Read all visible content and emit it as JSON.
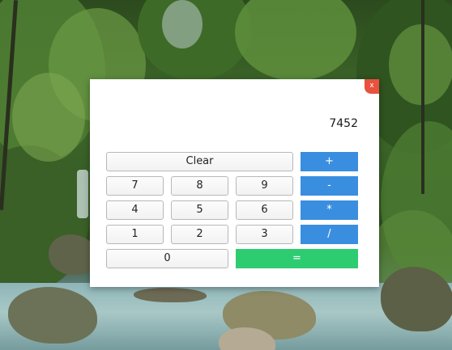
{
  "window": {
    "close_label": "x"
  },
  "calculator": {
    "display_value": "7452",
    "buttons": {
      "clear": "Clear",
      "add": "+",
      "subtract": "-",
      "multiply": "*",
      "divide": "/",
      "equals": "=",
      "d7": "7",
      "d8": "8",
      "d9": "9",
      "d4": "4",
      "d5": "5",
      "d6": "6",
      "d1": "1",
      "d2": "2",
      "d3": "3",
      "d0": "0"
    }
  },
  "colors": {
    "operator_button": "#3a8ee0",
    "equals_button": "#2ecc71",
    "close_button": "#e8523e"
  }
}
